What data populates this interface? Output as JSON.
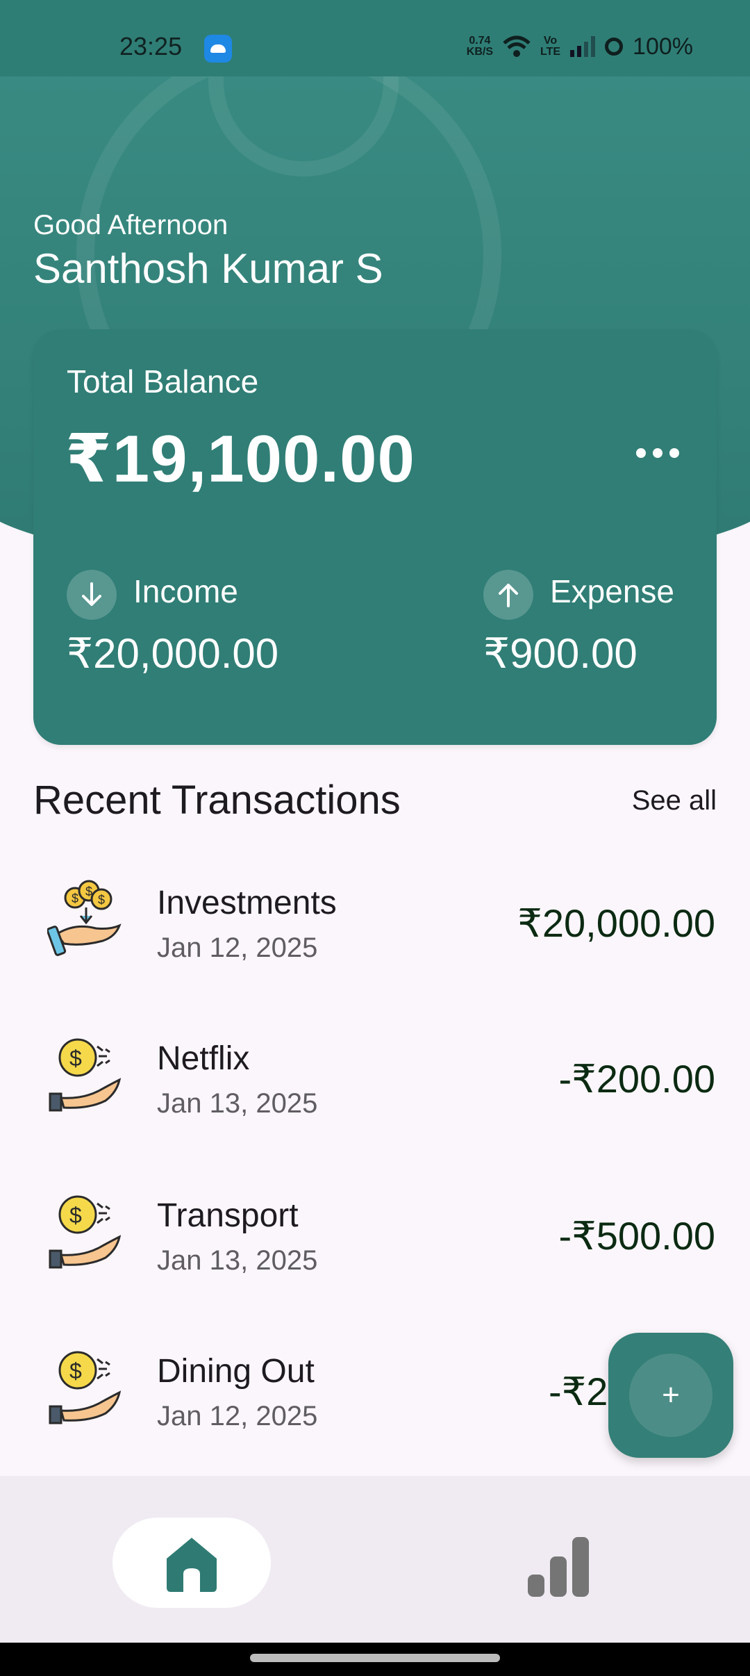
{
  "status_bar": {
    "time": "23:25",
    "net_speed_value": "0.74",
    "net_speed_unit": "KB/S",
    "volte_top": "Vo",
    "volte_bottom": "LTE",
    "battery": "100%"
  },
  "header": {
    "greeting": "Good Afternoon",
    "user_name": "Santhosh Kumar S"
  },
  "balance_card": {
    "label": "Total Balance",
    "amount": "₹19,100.00",
    "income_label": "Income",
    "income_value": "₹20,000.00",
    "expense_label": "Expense",
    "expense_value": "₹900.00"
  },
  "recent": {
    "title": "Recent Transactions",
    "see_all": "See all",
    "items": [
      {
        "name": "Investments",
        "date": "Jan 12, 2025",
        "amount": "₹20,000.00",
        "icon": "investment-icon"
      },
      {
        "name": "Netflix",
        "date": "Jan 13, 2025",
        "amount": "-₹200.00",
        "icon": "expense-coin-icon"
      },
      {
        "name": "Transport",
        "date": "Jan 13, 2025",
        "amount": "-₹500.00",
        "icon": "expense-coin-icon"
      },
      {
        "name": "Dining Out",
        "date": "Jan 12, 2025",
        "amount": "-₹2",
        "icon": "expense-coin-icon"
      }
    ]
  },
  "fab": {
    "label": "+"
  },
  "bottom_nav": {
    "items": [
      {
        "id": "home",
        "icon": "home-icon",
        "selected": true
      },
      {
        "id": "stats",
        "icon": "bar-chart-icon",
        "selected": false
      }
    ]
  },
  "colors": {
    "primary": "#307e76",
    "background": "#fbf6fb",
    "nav_background": "#f0ebf2"
  }
}
